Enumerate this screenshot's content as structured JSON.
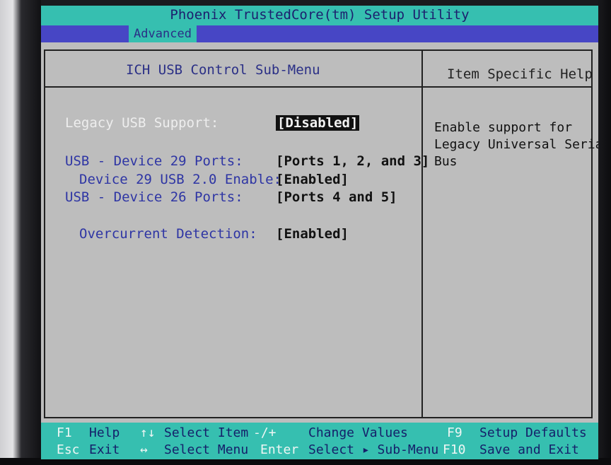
{
  "app": {
    "title": "Phoenix TrustedCore(tm) Setup Utility"
  },
  "menu": {
    "active_tab": "Advanced"
  },
  "submenu": {
    "title": "ICH USB Control Sub-Menu"
  },
  "help": {
    "title": "Item Specific Help",
    "lines": [
      "Enable support for",
      "Legacy Universal Serial",
      "Bus"
    ]
  },
  "settings": [
    {
      "label": "Legacy USB Support:",
      "value": "[Disabled]"
    },
    {
      "label": "USB - Device 29 Ports:",
      "value": "[Ports 1, 2, and 3]"
    },
    {
      "label": "Device 29 USB 2.0 Enable:",
      "value": "[Enabled]"
    },
    {
      "label": "USB - Device 26 Ports:",
      "value": "[Ports 4 and 5]"
    },
    {
      "label": "Overcurrent Detection:",
      "value": "[Enabled]"
    }
  ],
  "footer": {
    "row1": [
      {
        "key": "F1",
        "label": "Help"
      },
      {
        "key": "↑↓",
        "label": "Select Item"
      },
      {
        "key": "-/+",
        "label": "Change Values"
      },
      {
        "key": "F9",
        "label": "Setup Defaults"
      }
    ],
    "row2": [
      {
        "key": "Esc",
        "label": "Exit"
      },
      {
        "key": "↔",
        "label": "Select Menu"
      },
      {
        "key": "Enter",
        "label": "Select ▸ Sub-Menu"
      },
      {
        "key": "F10",
        "label": "Save and Exit"
      }
    ]
  }
}
